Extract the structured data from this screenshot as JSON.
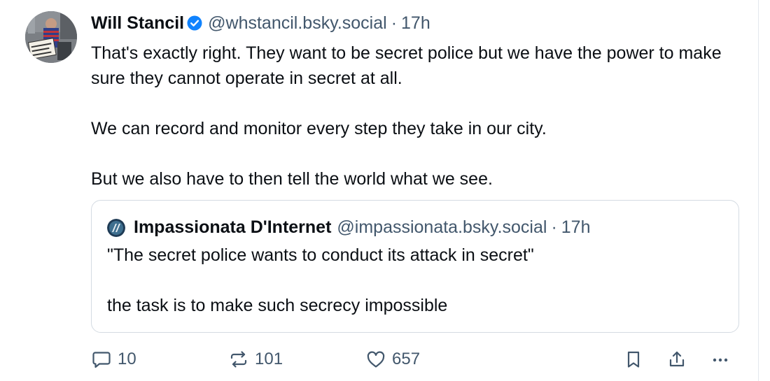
{
  "post": {
    "author": {
      "display_name": "Will Stancil",
      "handle": "@whstancil.bsky.social",
      "verified": true,
      "avatar_sign_text": "There are more of us than them"
    },
    "separator": "·",
    "timestamp": "17h",
    "body": [
      "That's exactly right. They want to be secret police but we have the power to make sure they cannot operate in secret at all.",
      "We can record and monitor every step they take in our city.",
      "But we also have to then tell the world what we see."
    ]
  },
  "quote": {
    "author": {
      "display_name": "Impassionata D'Internet",
      "handle": "@impassionata.bsky.social"
    },
    "separator": "·",
    "timestamp": "17h",
    "body": [
      "\"The secret police wants to conduct its attack in secret\"",
      "the task is to make such secrecy impossible"
    ]
  },
  "actions": {
    "reply": {
      "icon": "reply-icon",
      "count": "10"
    },
    "repost": {
      "icon": "repost-icon",
      "count": "101"
    },
    "like": {
      "icon": "heart-icon",
      "count": "657"
    },
    "bookmark": {
      "icon": "bookmark-icon"
    },
    "share": {
      "icon": "share-icon"
    },
    "more": {
      "icon": "more-icon"
    }
  },
  "colors": {
    "text": "#0b0f14",
    "muted": "#42576c",
    "verified": "#1083fe",
    "border": "#d4dbe2"
  }
}
